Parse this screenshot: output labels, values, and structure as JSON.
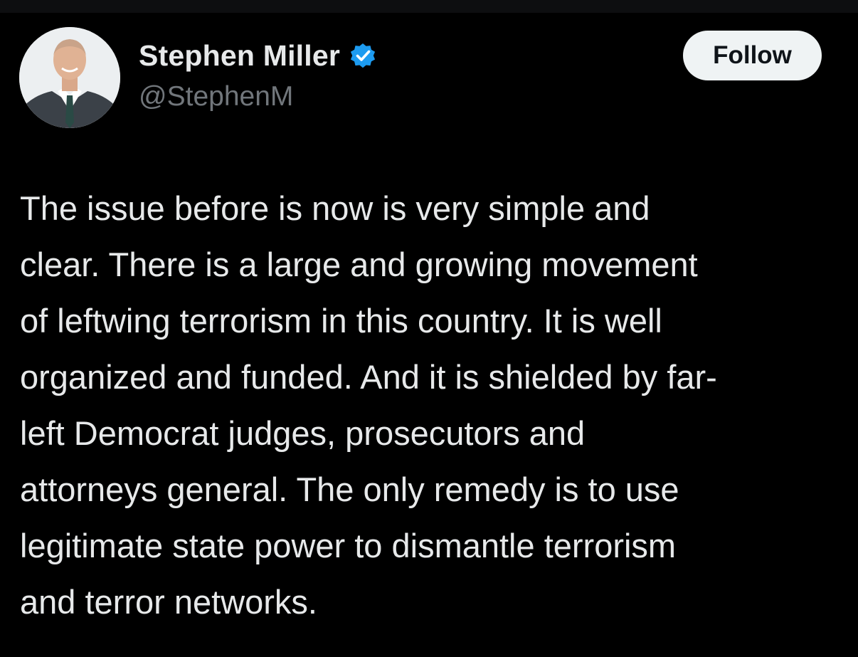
{
  "colors": {
    "background": "#000000",
    "text_primary": "#e7e9ea",
    "text_secondary": "#71767b",
    "verified_blue": "#1d9bf0",
    "follow_button_bg": "#eff3f4",
    "follow_button_text": "#0f1419"
  },
  "author": {
    "avatar_icon": "profile-photo",
    "name": "Stephen Miller",
    "verified_icon": "verified-badge-icon",
    "handle": "@StephenM"
  },
  "actions": {
    "follow_label": "Follow"
  },
  "post": {
    "lines": [
      "The issue before is now is very simple and",
      "clear. There is a large and growing movement",
      "of leftwing terrorism in this country. It is well",
      "organized and funded. And it is shielded by far-",
      "left Democrat judges, prosecutors and",
      "attorneys general. The only remedy is to use",
      "legitimate state power to dismantle terrorism",
      "and terror networks."
    ]
  }
}
